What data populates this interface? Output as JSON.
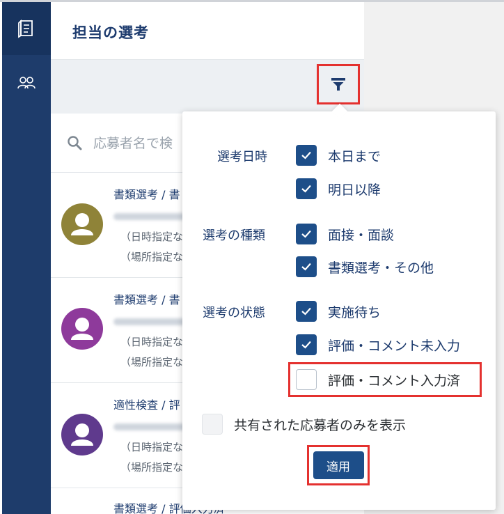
{
  "page": {
    "title": "担当の選考"
  },
  "search": {
    "placeholder": "応募者名で検"
  },
  "list": [
    {
      "title": "書類選考 / 書",
      "line1": "（日時指定な",
      "line2": "（場所指定な",
      "avatar_color": "#8f8338"
    },
    {
      "title": "書類選考 / 書",
      "line1": "（日時指定な",
      "line2": "（場所指定な",
      "avatar_color": "#8e3a9b"
    },
    {
      "title": "適性検査 / 評",
      "line1": "（日時指定な",
      "line2": "（場所指定な",
      "avatar_color": "#5f3a8d"
    },
    {
      "title": "書類選考 / 評価入力済"
    }
  ],
  "filter": {
    "groups": [
      {
        "label": "選考日時",
        "options": [
          {
            "label": "本日まで",
            "checked": true
          },
          {
            "label": "明日以降",
            "checked": true
          }
        ]
      },
      {
        "label": "選考の種類",
        "options": [
          {
            "label": "面接・面談",
            "checked": true
          },
          {
            "label": "書類選考・その他",
            "checked": true
          }
        ]
      },
      {
        "label": "選考の状態",
        "options": [
          {
            "label": "実施待ち",
            "checked": true
          },
          {
            "label": "評価・コメント未入力",
            "checked": true
          },
          {
            "label": "評価・コメント入力済",
            "checked": false
          }
        ]
      }
    ],
    "shared_only": {
      "label": "共有された応募者のみを表示",
      "checked": false
    },
    "apply_label": "適用"
  },
  "colors": {
    "sidebar": "#1e3c6b",
    "accent": "#1d4e89",
    "highlight": "#e4312f"
  }
}
